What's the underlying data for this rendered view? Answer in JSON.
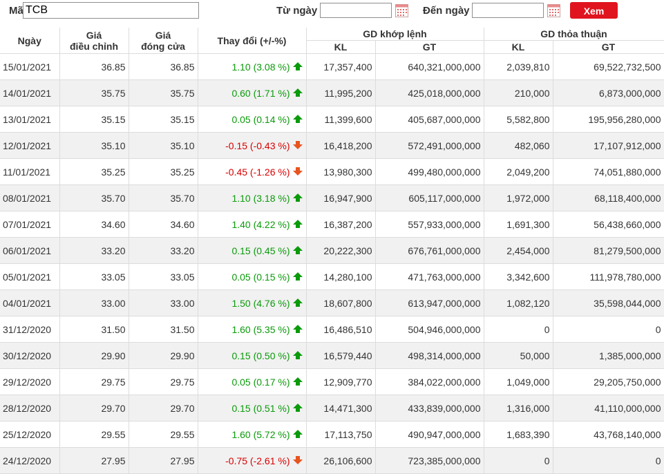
{
  "filter": {
    "ma_label": "Mã",
    "ma_value": "TCB",
    "from_label": "Từ ngày",
    "from_value": "",
    "to_label": "Đến ngày",
    "to_value": "",
    "submit_label": "Xem",
    "calendar_icon": "calendar-icon"
  },
  "colors": {
    "up": "#0a9a0a",
    "down": "#d90000",
    "button": "#e0141e",
    "stripe": "#f1f1f1"
  },
  "table": {
    "headers": {
      "ngay": "Ngày",
      "gia_dc_1": "Giá",
      "gia_dc_2": "điều chỉnh",
      "gia_dong_1": "Giá",
      "gia_dong_2": "đóng cửa",
      "thaydoi": "Thay đổi (+/-%)",
      "khop": "GD khớp lệnh",
      "khop_kl": "KL",
      "khop_gt": "GT",
      "thoathuan": "GD thỏa thuận",
      "tt_kl": "KL",
      "tt_gt": "GT"
    },
    "rows": [
      {
        "date": "15/01/2021",
        "adj": "36.85",
        "close": "36.85",
        "change": "1.10 (3.08 %)",
        "dir": "up",
        "kl": "17,357,400",
        "gt": "640,321,000,000",
        "tt_kl": "2,039,810",
        "tt_gt": "69,522,732,500"
      },
      {
        "date": "14/01/2021",
        "adj": "35.75",
        "close": "35.75",
        "change": "0.60 (1.71 %)",
        "dir": "up",
        "kl": "11,995,200",
        "gt": "425,018,000,000",
        "tt_kl": "210,000",
        "tt_gt": "6,873,000,000"
      },
      {
        "date": "13/01/2021",
        "adj": "35.15",
        "close": "35.15",
        "change": "0.05 (0.14 %)",
        "dir": "up",
        "kl": "11,399,600",
        "gt": "405,687,000,000",
        "tt_kl": "5,582,800",
        "tt_gt": "195,956,280,000"
      },
      {
        "date": "12/01/2021",
        "adj": "35.10",
        "close": "35.10",
        "change": "-0.15 (-0.43 %)",
        "dir": "down",
        "kl": "16,418,200",
        "gt": "572,491,000,000",
        "tt_kl": "482,060",
        "tt_gt": "17,107,912,000"
      },
      {
        "date": "11/01/2021",
        "adj": "35.25",
        "close": "35.25",
        "change": "-0.45 (-1.26 %)",
        "dir": "down",
        "kl": "13,980,300",
        "gt": "499,480,000,000",
        "tt_kl": "2,049,200",
        "tt_gt": "74,051,880,000"
      },
      {
        "date": "08/01/2021",
        "adj": "35.70",
        "close": "35.70",
        "change": "1.10 (3.18 %)",
        "dir": "up",
        "kl": "16,947,900",
        "gt": "605,117,000,000",
        "tt_kl": "1,972,000",
        "tt_gt": "68,118,400,000"
      },
      {
        "date": "07/01/2021",
        "adj": "34.60",
        "close": "34.60",
        "change": "1.40 (4.22 %)",
        "dir": "up",
        "kl": "16,387,200",
        "gt": "557,933,000,000",
        "tt_kl": "1,691,300",
        "tt_gt": "56,438,660,000"
      },
      {
        "date": "06/01/2021",
        "adj": "33.20",
        "close": "33.20",
        "change": "0.15 (0.45 %)",
        "dir": "up",
        "kl": "20,222,300",
        "gt": "676,761,000,000",
        "tt_kl": "2,454,000",
        "tt_gt": "81,279,500,000"
      },
      {
        "date": "05/01/2021",
        "adj": "33.05",
        "close": "33.05",
        "change": "0.05 (0.15 %)",
        "dir": "up",
        "kl": "14,280,100",
        "gt": "471,763,000,000",
        "tt_kl": "3,342,600",
        "tt_gt": "111,978,780,000"
      },
      {
        "date": "04/01/2021",
        "adj": "33.00",
        "close": "33.00",
        "change": "1.50 (4.76 %)",
        "dir": "up",
        "kl": "18,607,800",
        "gt": "613,947,000,000",
        "tt_kl": "1,082,120",
        "tt_gt": "35,598,044,000"
      },
      {
        "date": "31/12/2020",
        "adj": "31.50",
        "close": "31.50",
        "change": "1.60 (5.35 %)",
        "dir": "up",
        "kl": "16,486,510",
        "gt": "504,946,000,000",
        "tt_kl": "0",
        "tt_gt": "0"
      },
      {
        "date": "30/12/2020",
        "adj": "29.90",
        "close": "29.90",
        "change": "0.15 (0.50 %)",
        "dir": "up",
        "kl": "16,579,440",
        "gt": "498,314,000,000",
        "tt_kl": "50,000",
        "tt_gt": "1,385,000,000"
      },
      {
        "date": "29/12/2020",
        "adj": "29.75",
        "close": "29.75",
        "change": "0.05 (0.17 %)",
        "dir": "up",
        "kl": "12,909,770",
        "gt": "384,022,000,000",
        "tt_kl": "1,049,000",
        "tt_gt": "29,205,750,000"
      },
      {
        "date": "28/12/2020",
        "adj": "29.70",
        "close": "29.70",
        "change": "0.15 (0.51 %)",
        "dir": "up",
        "kl": "14,471,300",
        "gt": "433,839,000,000",
        "tt_kl": "1,316,000",
        "tt_gt": "41,110,000,000"
      },
      {
        "date": "25/12/2020",
        "adj": "29.55",
        "close": "29.55",
        "change": "1.60 (5.72 %)",
        "dir": "up",
        "kl": "17,113,750",
        "gt": "490,947,000,000",
        "tt_kl": "1,683,390",
        "tt_gt": "43,768,140,000"
      },
      {
        "date": "24/12/2020",
        "adj": "27.95",
        "close": "27.95",
        "change": "-0.75 (-2.61 %)",
        "dir": "down",
        "kl": "26,106,600",
        "gt": "723,385,000,000",
        "tt_kl": "0",
        "tt_gt": "0"
      }
    ]
  }
}
